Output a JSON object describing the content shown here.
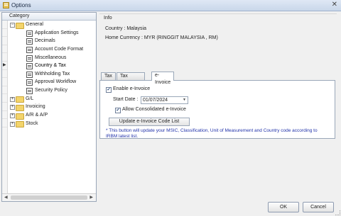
{
  "window": {
    "title": "Options",
    "close_glyph": "✕",
    "icon": "options-app-icon"
  },
  "category_panel": {
    "header": "Category",
    "items": [
      {
        "label": "General",
        "type": "folder",
        "expander": "−"
      },
      {
        "label": "Application Settings",
        "type": "page"
      },
      {
        "label": "Decimals",
        "type": "page"
      },
      {
        "label": "Account Code Format",
        "type": "page"
      },
      {
        "label": "Miscellaneous",
        "type": "page"
      },
      {
        "label": "Country & Tax",
        "type": "page",
        "selected": true
      },
      {
        "label": "Withholding Tax",
        "type": "page"
      },
      {
        "label": "Approval Workflow",
        "type": "page"
      },
      {
        "label": "Security Policy",
        "type": "page"
      },
      {
        "label": "G/L",
        "type": "folder",
        "expander": "+"
      },
      {
        "label": "Invoicing",
        "type": "folder",
        "expander": "+"
      },
      {
        "label": "A/R & A/P",
        "type": "folder",
        "expander": "+"
      },
      {
        "label": "Stock",
        "type": "folder",
        "expander": "+"
      }
    ],
    "scroll_left": "◀",
    "scroll_right": "▶",
    "row_arrow": "▶"
  },
  "info": {
    "title": "Info",
    "country": "Country : Malaysia",
    "home_currency": "Home Currency : MYR (RINGGIT MALAYSIA , RM)"
  },
  "tabs": [
    {
      "label": "Tax",
      "active": false
    },
    {
      "label": "Tax Reporting",
      "active": false
    },
    {
      "label": "e-Invoice",
      "active": true
    }
  ],
  "einvoice": {
    "enable_label": "Enable e-Invoice",
    "enable_checked": true,
    "start_date_label": "Start Date :",
    "start_date_value": "01/07/2024",
    "dropdown_glyph": "▼",
    "allow_consolidated_label": "Allow Consolidated e-Invoice",
    "allow_consolidated_checked": true,
    "update_button": "Update e-Invoice Code List",
    "note": "* This button will update your MSIC, Classification, Unit of Measurement and Country code according to IRBM latest list.",
    "check_glyph": "✔"
  },
  "footer": {
    "ok": "OK",
    "cancel": "Cancel"
  },
  "colors": {
    "note_text": "#2233aa",
    "folder": "#f3d46b"
  }
}
